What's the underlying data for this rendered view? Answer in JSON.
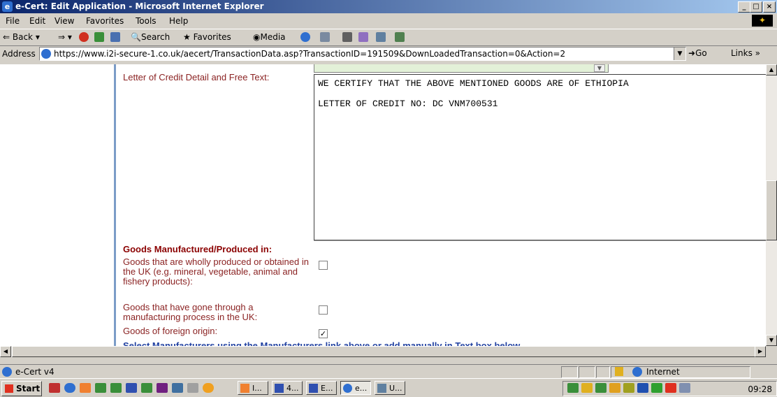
{
  "window": {
    "title": "e-Cert: Edit Application - Microsoft Internet Explorer",
    "min_icon": "minimize-icon",
    "max_icon": "maximize-icon",
    "close_icon": "close-icon"
  },
  "menu": {
    "items": [
      "File",
      "Edit",
      "View",
      "Favorites",
      "Tools",
      "Help"
    ]
  },
  "toolbar": {
    "back": "Back",
    "search": "Search",
    "favorites": "Favorites",
    "media": "Media"
  },
  "address": {
    "label": "Address",
    "url": "https://www.i2i-secure-1.co.uk/aecert/TransactionData.asp?TransactionID=191509&DownLoadedTransaction=0&Action=2",
    "go": "Go",
    "links": "Links"
  },
  "form": {
    "lc_label": "Letter of Credit Detail and Free Text:",
    "lc_text_line1": "WE CERTIFY THAT THE ABOVE MENTIONED GOODS ARE OF ETHIOPIA",
    "lc_text_line2": "LETTER OF CREDIT NO: DC VNM700531",
    "goods_header": "Goods Manufactured/Produced in:",
    "goods_options": [
      {
        "label": "Goods that are wholly produced or obtained in the UK (e.g. mineral, vegetable, animal and fishery products):",
        "checked": false
      },
      {
        "label": "Goods that have gone through a manufacturing process in the UK:",
        "checked": false
      },
      {
        "label": "Goods of foreign origin:",
        "checked": true
      }
    ],
    "manufacturers_note": "Select Manufacturers using the Manufacturers link above or add manually in Text box below."
  },
  "status": {
    "text": "e-Cert v4",
    "zone": "Internet"
  },
  "taskbar": {
    "start": "Start",
    "tasks": [
      "I...",
      "4...",
      "E...",
      "e...",
      "U..."
    ],
    "clock": "09:28"
  },
  "colors": {
    "titlebar_start": "#0a246a",
    "label_red": "#8b2323",
    "link_blue": "#2040a0",
    "sidebar_border": "#7b9cc7",
    "field_green": "#e3f1d8"
  }
}
